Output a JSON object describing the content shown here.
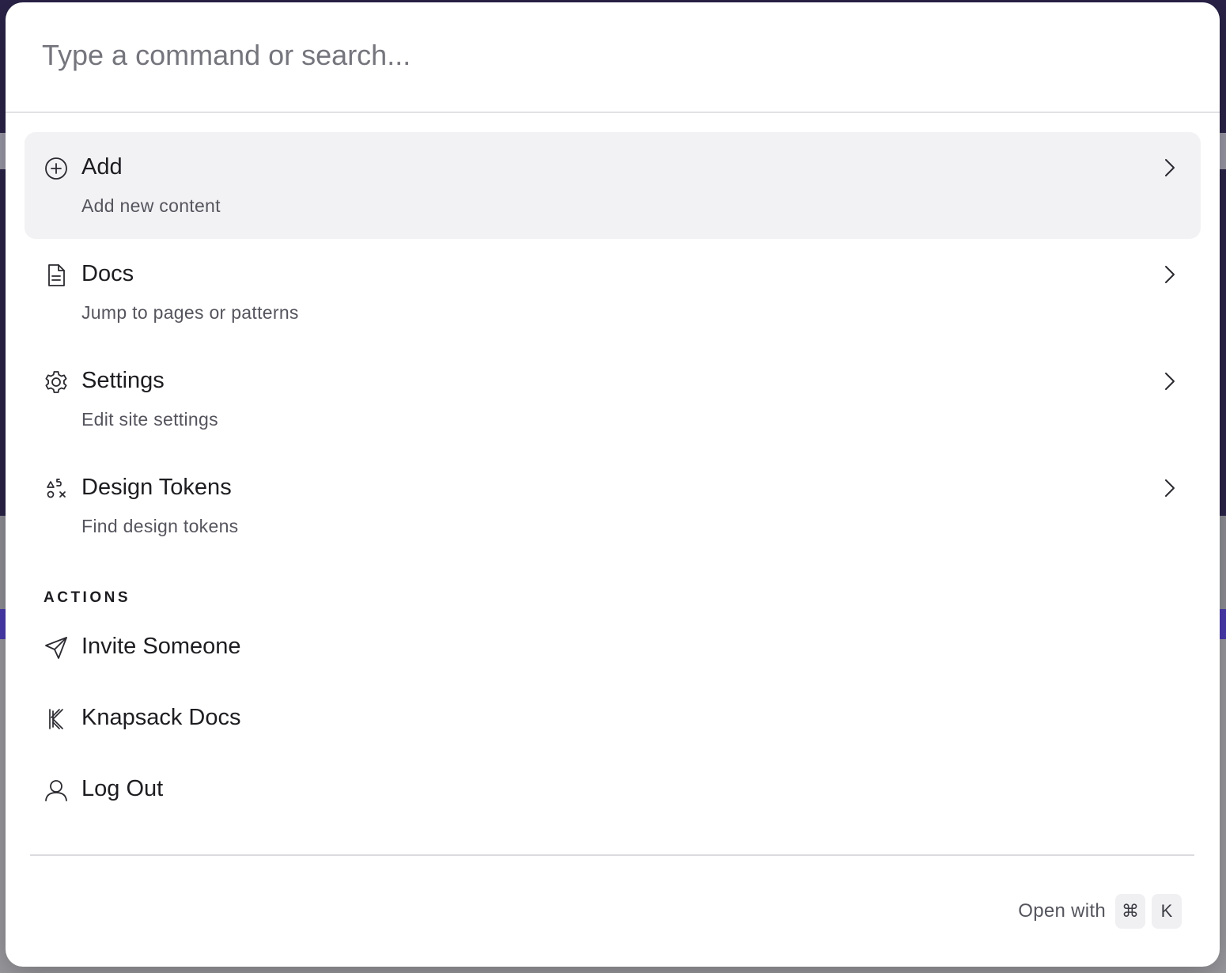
{
  "search": {
    "placeholder": "Type a command or search..."
  },
  "items": [
    {
      "icon": "plus-circle-icon",
      "title": "Add",
      "description": "Add new content",
      "active": true
    },
    {
      "icon": "document-icon",
      "title": "Docs",
      "description": "Jump to pages or patterns",
      "active": false
    },
    {
      "icon": "gear-icon",
      "title": "Settings",
      "description": "Edit site settings",
      "active": false
    },
    {
      "icon": "design-tokens-icon",
      "title": "Design Tokens",
      "description": "Find design tokens",
      "active": false
    }
  ],
  "actions": {
    "label": "ACTIONS",
    "items": [
      {
        "icon": "send-icon",
        "title": "Invite Someone"
      },
      {
        "icon": "knapsack-logo-icon",
        "title": "Knapsack Docs"
      },
      {
        "icon": "user-icon",
        "title": "Log Out"
      }
    ]
  },
  "footer": {
    "open_with": "Open with",
    "keys": [
      "⌘",
      "K"
    ]
  },
  "colors": {
    "active_bg": "#f2f2f4",
    "text": "#1d1d21",
    "muted": "#55555e"
  }
}
